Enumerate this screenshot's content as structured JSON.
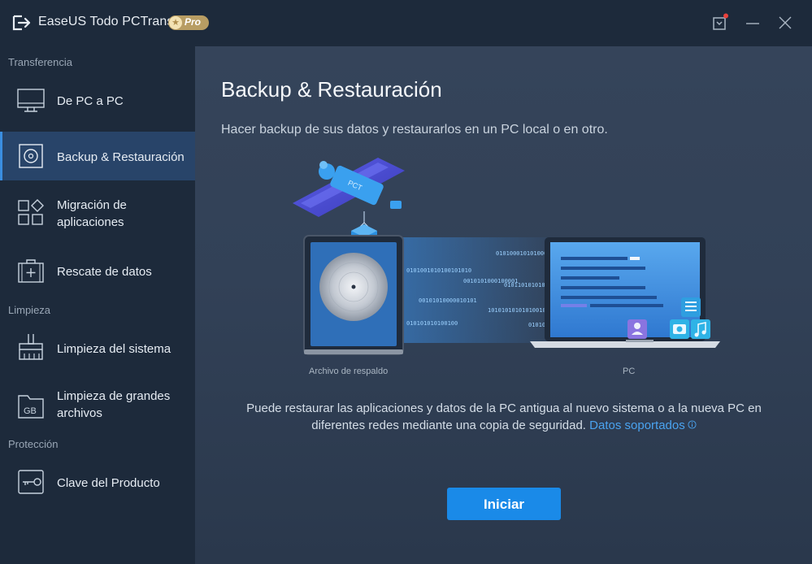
{
  "titlebar": {
    "app_title": "EaseUS Todo PCTrans",
    "pro_badge": "Pro"
  },
  "sidebar": {
    "sections": [
      {
        "label": "Transferencia"
      },
      {
        "label": "Limpieza"
      },
      {
        "label": "Protección"
      }
    ],
    "items": [
      {
        "label": "De PC a PC",
        "icon": "monitor-icon"
      },
      {
        "label": "Backup & Restauración",
        "icon": "disc-icon",
        "active": true
      },
      {
        "label": "Migración de aplicaciones",
        "icon": "apps-grid-icon"
      },
      {
        "label": "Rescate de datos",
        "icon": "first-aid-kit-icon"
      },
      {
        "label": "Limpieza del sistema",
        "icon": "broom-icon"
      },
      {
        "label": "Limpieza de grandes archivos",
        "icon": "gb-folder-icon"
      },
      {
        "label": "Clave del Producto",
        "icon": "key-icon"
      }
    ]
  },
  "main": {
    "title": "Backup & Restauración",
    "subtitle": "Hacer backup de sus datos y restaurarlos en un PC local o en otro.",
    "illustration": {
      "satellite_label": "PCT",
      "binary_streams": [
        "0101000101010001010",
        "0101001010100101010",
        "0010101000100001",
        "0101101010101000011",
        "00101010000010101",
        "101010101010100100",
        "010101010100100",
        "0101010101"
      ],
      "left_caption": "Archivo de respaldo",
      "right_caption": "PC"
    },
    "description": "Puede restaurar las aplicaciones y datos de la PC antigua al nuevo sistema o a la nueva PC en diferentes redes mediante una copia de seguridad.",
    "link_text": "Datos soportados",
    "start_button": "Iniciar"
  },
  "colors": {
    "accent": "#1a8ae8",
    "sidebar_bg": "#1d2a3b",
    "active_item": "#284469",
    "link": "#4aa3f0"
  }
}
